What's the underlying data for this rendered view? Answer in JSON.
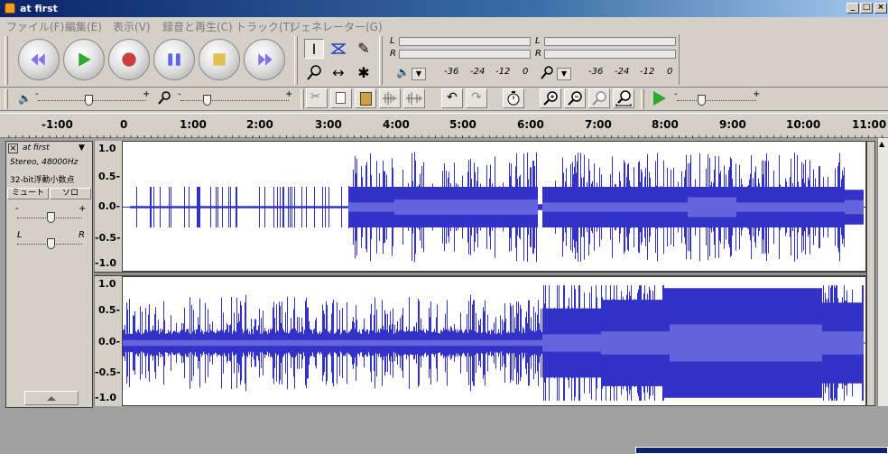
{
  "window": {
    "title": "at first",
    "minimize_label": "_",
    "maximize_label": "□",
    "close_label": "×"
  },
  "menu": [
    "ファイル(F)",
    "編集(E)",
    "表示(V)",
    "録音と再生(C)",
    "トラック(T)",
    "ジェネレーター(G)"
  ],
  "meters": {
    "left_label": "L",
    "right_label": "R",
    "playback_ticks": [
      "-36",
      "-24",
      "-12",
      "0"
    ],
    "record_ticks": [
      "-36",
      "-24",
      "-12",
      "0"
    ]
  },
  "mixer": {
    "minus": "-",
    "plus": "+"
  },
  "ruler": {
    "labels": [
      "-1:00",
      "0",
      "1:00",
      "2:00",
      "3:00",
      "4:00",
      "5:00",
      "6:00",
      "7:00",
      "8:00",
      "9:00",
      "10:00",
      "11:00"
    ]
  },
  "track": {
    "name": "at first",
    "format": "Stereo, 48000Hz",
    "bitdepth": "32-bit浮動小数点",
    "mute_label": "ミュート",
    "solo_label": "ソロ",
    "gain_minus": "-",
    "gain_plus": "+",
    "pan_left": "L",
    "pan_right": "R",
    "collapse_icon": "up-triangle-icon",
    "scale": [
      "1.0",
      "0.5-",
      "0.0-",
      "-0.5-",
      "-1.0"
    ]
  },
  "colors": {
    "wave_dark": "#3232c8",
    "wave_light": "#6464dc",
    "title_bar": "#0a246a"
  }
}
